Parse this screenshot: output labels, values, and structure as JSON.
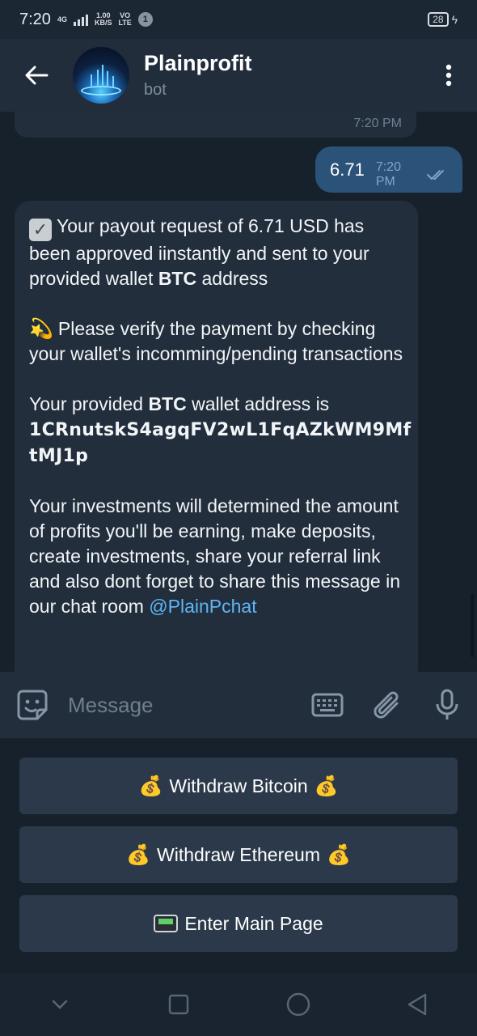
{
  "status_bar": {
    "time": "7:20",
    "network_type": "4G",
    "speed_value": "1.00",
    "speed_unit": "KB/S",
    "carrier_top": "VO",
    "carrier_bottom": "LTE",
    "notification_count": "1",
    "battery": "28"
  },
  "header": {
    "title": "Plainprofit",
    "subtitle": "bot",
    "back_icon": "arrow-left-icon",
    "menu_icon": "more-vertical-icon"
  },
  "messages": {
    "previous_time": "7:20 PM",
    "outgoing": {
      "text": "6.71",
      "time": "7:20 PM",
      "status_icon": "double-check-icon"
    },
    "incoming": {
      "p1": "Your payout request of 6.71 USD has been approved iinstantly and sent to your provided wallet",
      "p1_bold": "BTC",
      "p1_end": "address",
      "p2": "Please verify the payment by checking your wallet's incomming/pending transactions",
      "p3_start": "Your provided",
      "p3_bold": "BTC",
      "p3_end": "wallet address is",
      "address_line1": "1CRnutskS4agqFV2wL1FqAZkWM9Mf",
      "address_line2": "tMJ1p",
      "p4": "Your investments will determined the amount of profits you'll be earning, make deposits, create investments, share your referral link and also dont forget to share this message in our chat room",
      "mention": "@PlainPchat"
    }
  },
  "input": {
    "placeholder": "Message",
    "emoji_icon": "sticker-smile-icon",
    "keyboard_icon": "keyboard-icon",
    "attach_icon": "paperclip-icon",
    "mic_icon": "microphone-icon"
  },
  "bot_keyboard": {
    "buttons": [
      {
        "label": "Withdraw Bitcoin",
        "icon": "money-bag-icon"
      },
      {
        "label": "Withdraw Ethereum",
        "icon": "money-bag-icon"
      },
      {
        "label": "Enter Main Page",
        "icon": "pager-icon"
      }
    ]
  },
  "colors": {
    "background": "#17212b",
    "header": "#212d3b",
    "outgoing_bubble": "#2b5278",
    "incoming_bubble": "#222e3c",
    "link": "#5eb5f7",
    "keyboard_button": "#2b394a"
  }
}
